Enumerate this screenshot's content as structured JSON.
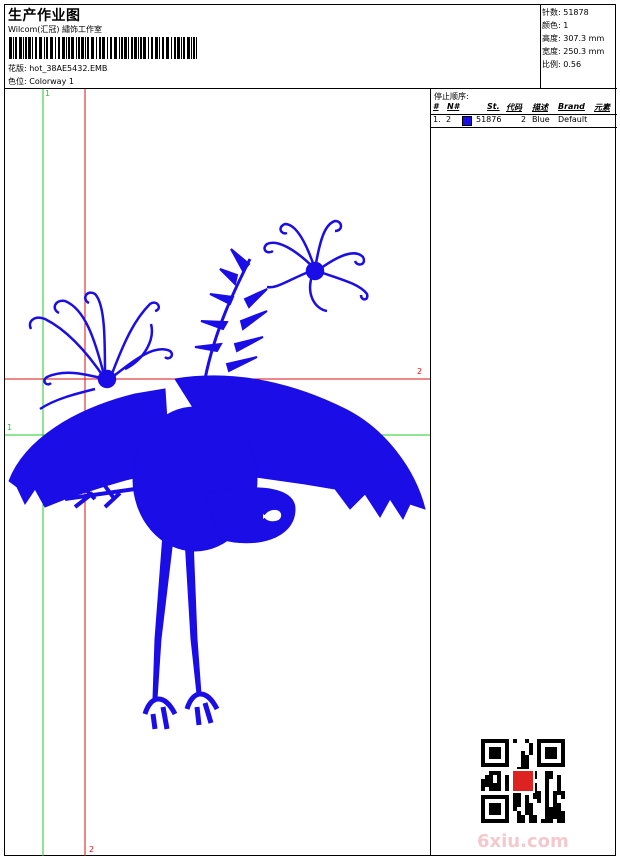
{
  "header": {
    "title": "生产作业图",
    "subtitle": "Wilcom(汇冠) 繡饰工作室",
    "design_label": "花版: hot_38AE5432.EMB",
    "colorway_label": "色位: Colorway 1"
  },
  "stats": {
    "stitches": "针数: 51878",
    "colors": "颜色: 1",
    "height": "高度: 307.3 mm",
    "width": "宽度: 250.3 mm",
    "scale": "比例: 0.56"
  },
  "stop_sequence": {
    "title": "停止顺序:",
    "columns": [
      "#",
      "N#",
      "St.",
      "代码",
      "描述",
      "Brand",
      "元素"
    ],
    "rows": [
      {
        "index": "1.",
        "needle": "2",
        "stitches": "51876",
        "code": "2",
        "description": "Blue",
        "brand": "Default",
        "swatch_color": "#1a0de6"
      }
    ]
  },
  "guides": {
    "vertical_green_label": "1",
    "vertical_red_label": "2",
    "horizontal_green_label": "1",
    "horizontal_red_label": "2"
  },
  "colors": {
    "embroidery_blue": "#1a0de6",
    "guide_green": "#22cc22",
    "guide_red": "#dd1111"
  },
  "watermark": "6xiu.com"
}
